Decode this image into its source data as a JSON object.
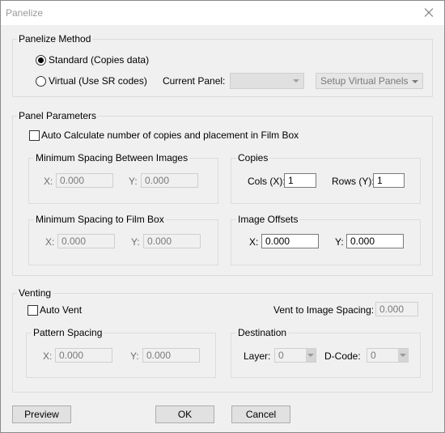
{
  "window": {
    "title": "Panelize"
  },
  "panelize_method": {
    "label": "Panelize Method",
    "standard_label": "Standard (Copies data)",
    "virtual_label": "Virtual  (Use SR codes)",
    "current_panel_label": "Current Panel:",
    "current_panel_value": "",
    "setup_button": "Setup Virtual Panels",
    "selected": "standard"
  },
  "panel_parameters": {
    "label": "Panel Parameters",
    "auto_calc_label": "Auto Calculate number of copies and placement in Film Box",
    "auto_calc_checked": false,
    "min_spacing_images": {
      "label": "Minimum Spacing Between Images",
      "x_label": "X:",
      "x_value": "0.000",
      "y_label": "Y:",
      "y_value": "0.000"
    },
    "copies": {
      "label": "Copies",
      "cols_label": "Cols (X):",
      "cols_value": "1",
      "rows_label": "Rows (Y):",
      "rows_value": "1"
    },
    "min_spacing_film": {
      "label": "Minimum Spacing to Film Box",
      "x_label": "X:",
      "x_value": "0.000",
      "y_label": "Y:",
      "y_value": "0.000"
    },
    "image_offsets": {
      "label": "Image Offsets",
      "x_label": "X:",
      "x_value": "0.000",
      "y_label": "Y:",
      "y_value": "0.000"
    }
  },
  "venting": {
    "label": "Venting",
    "auto_vent_label": "Auto Vent",
    "auto_vent_checked": false,
    "vent_spacing_label": "Vent to Image Spacing:",
    "vent_spacing_value": "0.000",
    "pattern_spacing": {
      "label": "Pattern Spacing",
      "x_label": "X:",
      "x_value": "0.000",
      "y_label": "Y:",
      "y_value": "0.000"
    },
    "destination": {
      "label": "Destination",
      "layer_label": "Layer:",
      "layer_value": "0",
      "dcode_label": "D-Code:",
      "dcode_value": "0"
    }
  },
  "buttons": {
    "preview": "Preview",
    "ok": "OK",
    "cancel": "Cancel"
  }
}
